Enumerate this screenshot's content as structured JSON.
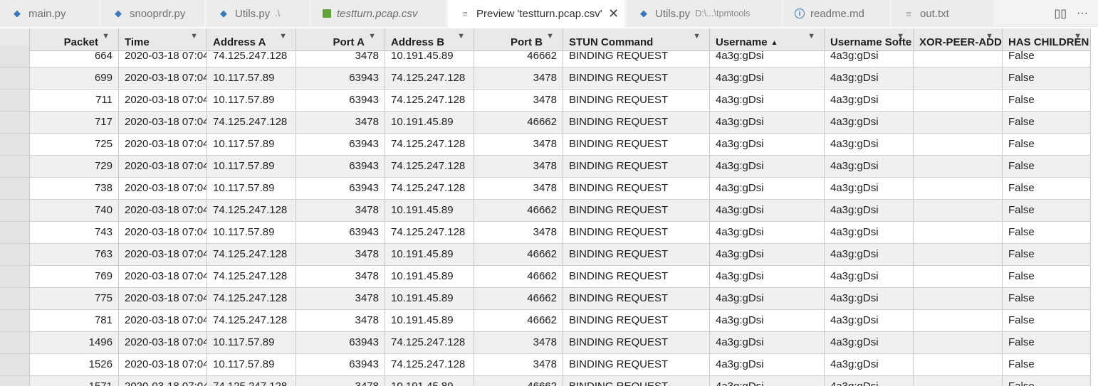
{
  "tabs": [
    {
      "label": "main.py",
      "desc": "",
      "icon": "python-icon",
      "italic": false,
      "active": false,
      "closable": false
    },
    {
      "label": "snooprdr.py",
      "desc": "",
      "icon": "python-icon",
      "italic": false,
      "active": false,
      "closable": false
    },
    {
      "label": "Utils.py",
      "desc": ".\\",
      "icon": "python-icon",
      "italic": false,
      "active": false,
      "closable": false
    },
    {
      "label": "testturn.pcap.csv",
      "desc": "",
      "icon": "csv-icon",
      "italic": true,
      "active": false,
      "closable": false
    },
    {
      "label": "Preview 'testturn.pcap.csv'",
      "desc": "",
      "icon": "preview-icon",
      "italic": false,
      "active": true,
      "closable": true
    },
    {
      "label": "Utils.py",
      "desc": "D:\\...\\tpmtools",
      "icon": "python-icon",
      "italic": false,
      "active": false,
      "closable": false
    },
    {
      "label": "readme.md",
      "desc": "",
      "icon": "info-icon",
      "italic": false,
      "active": false,
      "closable": false
    },
    {
      "label": "out.txt",
      "desc": "",
      "icon": "text-file-icon",
      "italic": false,
      "active": false,
      "closable": false
    }
  ],
  "tabbar_actions": {
    "split": "▯▯",
    "more": "···"
  },
  "columns": [
    {
      "label": "Packet",
      "align": "num",
      "filter": true,
      "sort": ""
    },
    {
      "label": "Time",
      "align": "txt",
      "filter": true,
      "sort": ""
    },
    {
      "label": "Address A",
      "align": "txt",
      "filter": true,
      "sort": ""
    },
    {
      "label": "Port A",
      "align": "num",
      "filter": true,
      "sort": ""
    },
    {
      "label": "Address B",
      "align": "txt",
      "filter": true,
      "sort": ""
    },
    {
      "label": "Port B",
      "align": "num",
      "filter": true,
      "sort": ""
    },
    {
      "label": "STUN Command",
      "align": "txt",
      "filter": true,
      "sort": ""
    },
    {
      "label": "Username",
      "align": "txt",
      "filter": true,
      "sort": "▲"
    },
    {
      "label": "Username Softe",
      "align": "txt",
      "filter": true,
      "sort": ""
    },
    {
      "label": "XOR-PEER-ADD",
      "align": "txt",
      "filter": true,
      "sort": ""
    },
    {
      "label": "HAS CHILDREN",
      "align": "txt",
      "filter": true,
      "sort": ""
    }
  ],
  "rows": [
    [
      "664",
      "2020-03-18 07:04",
      "74.125.247.128",
      "3478",
      "10.191.45.89",
      "46662",
      "BINDING REQUEST",
      "4a3g:gDsi",
      "4a3g:gDsi",
      "",
      "False"
    ],
    [
      "699",
      "2020-03-18 07:04",
      "10.117.57.89",
      "63943",
      "74.125.247.128",
      "3478",
      "BINDING REQUEST",
      "4a3g:gDsi",
      "4a3g:gDsi",
      "",
      "False"
    ],
    [
      "711",
      "2020-03-18 07:04",
      "10.117.57.89",
      "63943",
      "74.125.247.128",
      "3478",
      "BINDING REQUEST",
      "4a3g:gDsi",
      "4a3g:gDsi",
      "",
      "False"
    ],
    [
      "717",
      "2020-03-18 07:04",
      "74.125.247.128",
      "3478",
      "10.191.45.89",
      "46662",
      "BINDING REQUEST",
      "4a3g:gDsi",
      "4a3g:gDsi",
      "",
      "False"
    ],
    [
      "725",
      "2020-03-18 07:04",
      "10.117.57.89",
      "63943",
      "74.125.247.128",
      "3478",
      "BINDING REQUEST",
      "4a3g:gDsi",
      "4a3g:gDsi",
      "",
      "False"
    ],
    [
      "729",
      "2020-03-18 07:04",
      "10.117.57.89",
      "63943",
      "74.125.247.128",
      "3478",
      "BINDING REQUEST",
      "4a3g:gDsi",
      "4a3g:gDsi",
      "",
      "False"
    ],
    [
      "738",
      "2020-03-18 07:04",
      "10.117.57.89",
      "63943",
      "74.125.247.128",
      "3478",
      "BINDING REQUEST",
      "4a3g:gDsi",
      "4a3g:gDsi",
      "",
      "False"
    ],
    [
      "740",
      "2020-03-18 07:04",
      "74.125.247.128",
      "3478",
      "10.191.45.89",
      "46662",
      "BINDING REQUEST",
      "4a3g:gDsi",
      "4a3g:gDsi",
      "",
      "False"
    ],
    [
      "743",
      "2020-03-18 07:04",
      "10.117.57.89",
      "63943",
      "74.125.247.128",
      "3478",
      "BINDING REQUEST",
      "4a3g:gDsi",
      "4a3g:gDsi",
      "",
      "False"
    ],
    [
      "763",
      "2020-03-18 07:04",
      "74.125.247.128",
      "3478",
      "10.191.45.89",
      "46662",
      "BINDING REQUEST",
      "4a3g:gDsi",
      "4a3g:gDsi",
      "",
      "False"
    ],
    [
      "769",
      "2020-03-18 07:04",
      "74.125.247.128",
      "3478",
      "10.191.45.89",
      "46662",
      "BINDING REQUEST",
      "4a3g:gDsi",
      "4a3g:gDsi",
      "",
      "False"
    ],
    [
      "775",
      "2020-03-18 07:04",
      "74.125.247.128",
      "3478",
      "10.191.45.89",
      "46662",
      "BINDING REQUEST",
      "4a3g:gDsi",
      "4a3g:gDsi",
      "",
      "False"
    ],
    [
      "781",
      "2020-03-18 07:04",
      "74.125.247.128",
      "3478",
      "10.191.45.89",
      "46662",
      "BINDING REQUEST",
      "4a3g:gDsi",
      "4a3g:gDsi",
      "",
      "False"
    ],
    [
      "1496",
      "2020-03-18 07:04",
      "10.117.57.89",
      "63943",
      "74.125.247.128",
      "3478",
      "BINDING REQUEST",
      "4a3g:gDsi",
      "4a3g:gDsi",
      "",
      "False"
    ],
    [
      "1526",
      "2020-03-18 07:04",
      "10.117.57.89",
      "63943",
      "74.125.247.128",
      "3478",
      "BINDING REQUEST",
      "4a3g:gDsi",
      "4a3g:gDsi",
      "",
      "False"
    ],
    [
      "1571",
      "2020-03-18 07:04",
      "74.125.247.128",
      "3478",
      "10.191.45.89",
      "46662",
      "BINDING REQUEST",
      "4a3g:gDsi",
      "4a3g:gDsi",
      "",
      "False"
    ]
  ]
}
